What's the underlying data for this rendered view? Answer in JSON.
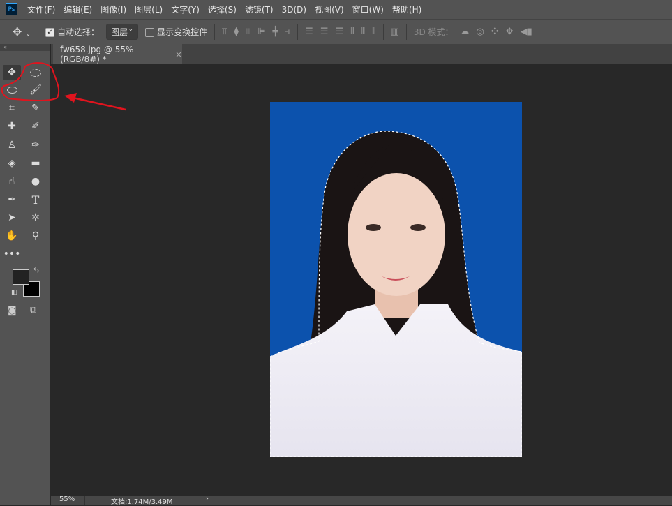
{
  "menubar": {
    "logo": "Ps",
    "items": [
      "文件(F)",
      "编辑(E)",
      "图像(I)",
      "图层(L)",
      "文字(Y)",
      "选择(S)",
      "滤镜(T)",
      "3D(D)",
      "视图(V)",
      "窗口(W)",
      "帮助(H)"
    ]
  },
  "options": {
    "auto_select_label": "自动选择：",
    "auto_select_checked": true,
    "layer_select": "图层",
    "show_transform_label": "显示变换控件",
    "show_transform_checked": false,
    "mode3d_label": "3D 模式："
  },
  "tab": {
    "title": "fw658.jpg @ 55%(RGB/8#) *",
    "close": "×"
  },
  "status": {
    "zoom": "55%",
    "doc": "文档:1.74M/3.49M",
    "arrow": "›"
  },
  "colors": {
    "annotation": "#e0141e",
    "photo_bg": "#0c52ad"
  }
}
